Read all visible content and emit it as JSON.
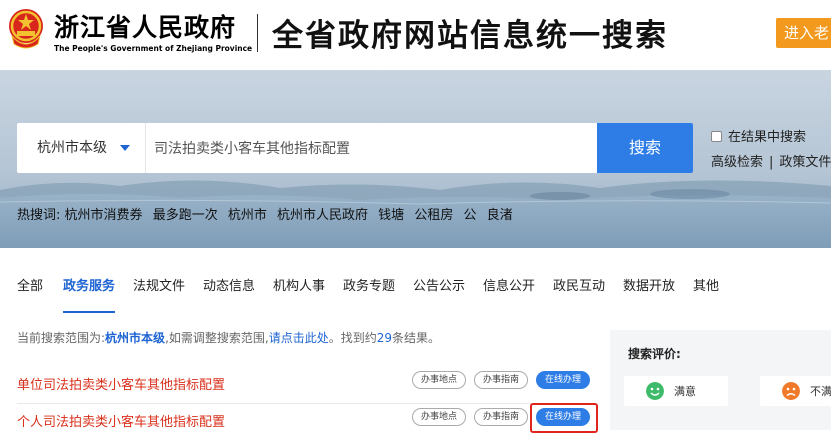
{
  "header": {
    "org_name_cn": "浙江省人民政府",
    "org_name_en": "The People's Government of Zhejiang Province",
    "site_title": "全省政府网站信息统一搜索",
    "enter_button": "进入老"
  },
  "search": {
    "scope": "杭州市本级",
    "query": "司法拍卖类小客车其他指标配置",
    "button": "搜索",
    "within_results": "在结果中搜索",
    "advanced_search": "高级检索",
    "advanced_sep": "|",
    "policy_docs": "政策文件"
  },
  "hotwords": {
    "label": "热搜词:",
    "items": [
      "杭州市消费券",
      "最多跑一次",
      "杭州市",
      "杭州市人民政府",
      "钱塘",
      "公租房",
      "公",
      "良渚"
    ]
  },
  "tabs": [
    {
      "label": "全部",
      "active": false
    },
    {
      "label": "政务服务",
      "active": true
    },
    {
      "label": "法规文件",
      "active": false
    },
    {
      "label": "动态信息",
      "active": false
    },
    {
      "label": "机构人事",
      "active": false
    },
    {
      "label": "政务专题",
      "active": false
    },
    {
      "label": "公告公示",
      "active": false
    },
    {
      "label": "信息公开",
      "active": false
    },
    {
      "label": "政民互动",
      "active": false
    },
    {
      "label": "数据开放",
      "active": false
    },
    {
      "label": "其他",
      "active": false
    }
  ],
  "scope_info": {
    "prefix": "当前搜索范围为:",
    "scope": "杭州市本级",
    "middle": ",如需调整搜索范围,",
    "link": "请点击此处",
    "found_prefix": "。找到约",
    "count": "29",
    "suffix": "条结果。"
  },
  "results": [
    {
      "title": "单位司法拍卖类小客车其他指标配置",
      "btn_location": "办事地点",
      "btn_guide": "办事指南",
      "btn_online": "在线办理"
    },
    {
      "title": "个人司法拍卖类小客车其他指标配置",
      "btn_location": "办事地点",
      "btn_guide": "办事指南",
      "btn_online": "在线办理"
    }
  ],
  "evaluation": {
    "title": "搜索评价:",
    "satisfied": "满意",
    "unsatisfied": "不满"
  },
  "colors": {
    "primary": "#2e7de6",
    "accent_orange": "#f39a1e",
    "result_red": "#d9301b",
    "highlight_red": "#e0261c"
  }
}
